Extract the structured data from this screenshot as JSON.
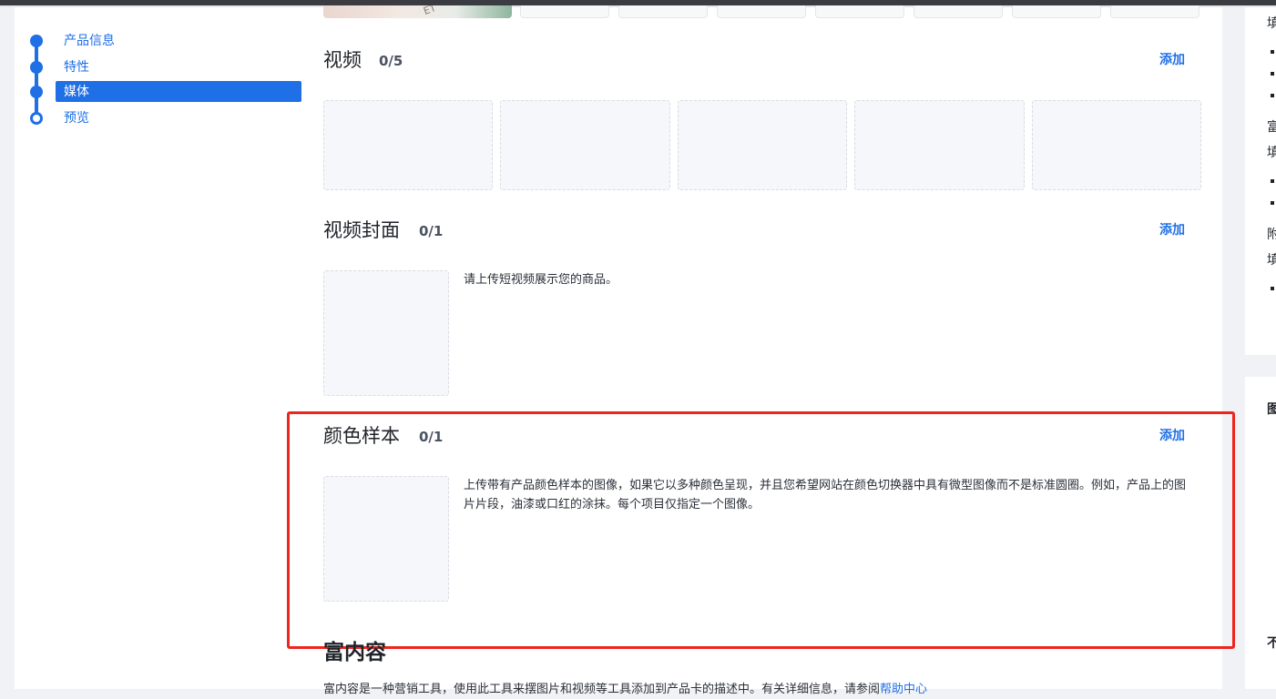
{
  "stepper": {
    "steps": [
      {
        "label": "产品信息",
        "state": "done"
      },
      {
        "label": "特性",
        "state": "done"
      },
      {
        "label": "媒体",
        "state": "active"
      },
      {
        "label": "预览",
        "state": "pending"
      }
    ]
  },
  "sections": {
    "video": {
      "title": "视频",
      "count": "0/5",
      "add": "添加"
    },
    "video_cover": {
      "title": "视频封面",
      "count": "0/1",
      "add": "添加",
      "description": "请上传短视频展示您的商品。"
    },
    "color_swatch": {
      "title": "颜色样本",
      "count": "0/1",
      "add": "添加",
      "description": "上传带有产品颜色样本的图像，如果它以多种颜色呈现，并且您希望网站在颜色切换器中具有微型图像而不是标准圆圈。例如，产品上的图片片段，油漆或口红的涂抹。每个项目仅指定一个图像。"
    },
    "rich_content": {
      "title": "富内容",
      "description": "富内容是一种营销工具，使用此工具来摆图片和视频等工具添加到产品卡的描述中。有关详细信息，请参阅",
      "link": "帮助中心"
    }
  },
  "right_edge": {
    "fragments": [
      "填",
      "富",
      "填",
      "附",
      "填",
      "图",
      "不"
    ]
  },
  "colors": {
    "accent": "#1f6fe6",
    "highlight_border": "#f0231d",
    "upload_bg": "#f6f7fa"
  }
}
